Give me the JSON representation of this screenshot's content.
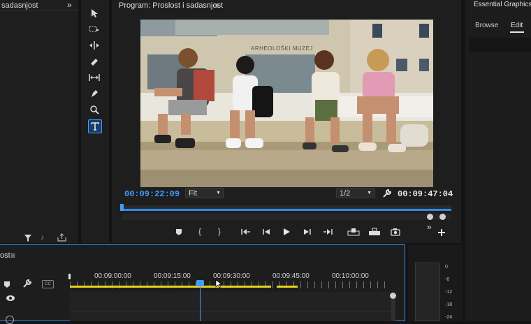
{
  "project_panel": {
    "title": "sadasnjost",
    "expand": "»"
  },
  "program_panel": {
    "title": "Program: Proslost i sadasnjost",
    "menu": "≡",
    "current_time": "00:09:22:09",
    "fit_label": "Fit",
    "resolution": "1/2",
    "duration": "00:09:47:04",
    "overflow": "»"
  },
  "essential_graphics": {
    "title": "Essential Graphics",
    "tabs": [
      "Browse",
      "Edit"
    ],
    "active_tab": "Edit"
  },
  "video_frame": {
    "sign_text": "ARHEOLOŠKI MUZEJ"
  },
  "timeline": {
    "title": "ost",
    "menu": "≡",
    "ruler_labels": [
      "00:09:00:00",
      "00:09:15:00",
      "00:09:30:00",
      "00:09:45:00",
      "00:10:00:00"
    ]
  },
  "audio_meter": {
    "labels": [
      "0",
      "-6",
      "-12",
      "-18",
      "-24"
    ]
  },
  "colors": {
    "accent": "#2d8ceb",
    "playhead": "#3f9dff",
    "work_area": "#e3d21c"
  }
}
